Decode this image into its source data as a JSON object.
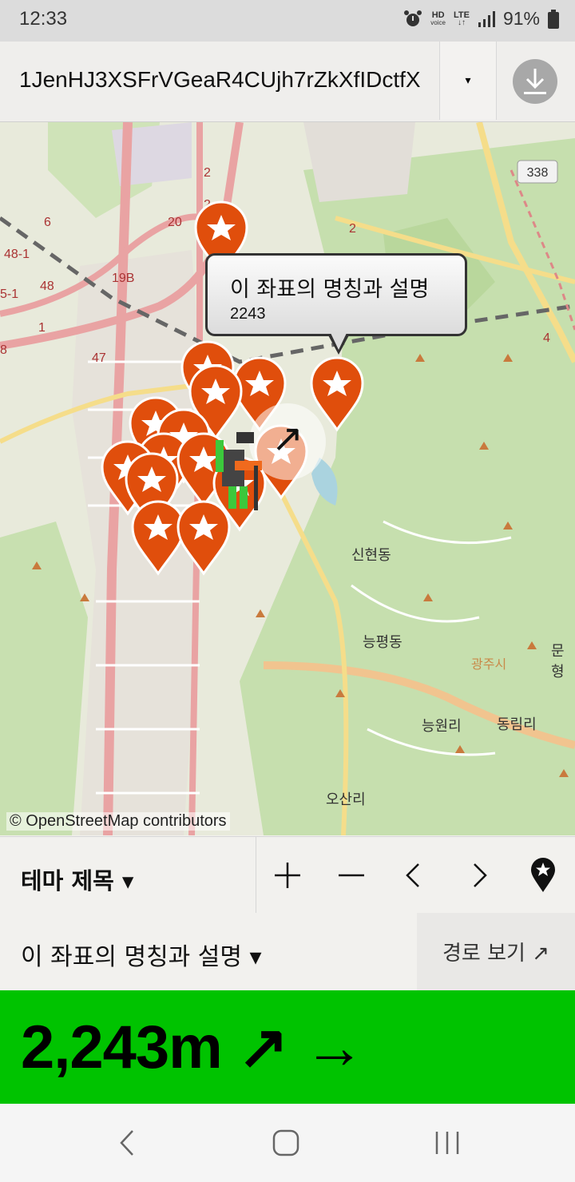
{
  "status": {
    "time": "12:33",
    "hd": "HD",
    "voice": "voice",
    "lte": "LTE",
    "battery": "91%"
  },
  "top": {
    "map_id": "1JenHJ3XSFrVGeaR4CUjh7rZkXfIDctfX",
    "dropdown_glyph": "▾",
    "download_icon": "download-icon"
  },
  "map": {
    "attribution": "© OpenStreetMap contributors",
    "places": [
      {
        "label": "신현동"
      },
      {
        "label": "능평동"
      },
      {
        "label": "능원리"
      },
      {
        "label": "동림리"
      },
      {
        "label": "오산리"
      },
      {
        "label": "문형"
      },
      {
        "label": "광주시"
      }
    ],
    "route_badges": [
      "338",
      "2",
      "2",
      "20",
      "19B",
      "6",
      "48-1",
      "48",
      "5-1",
      "1",
      "47",
      "8",
      "2",
      "4"
    ],
    "popup": {
      "title": "이 좌표의 명칭과 설명",
      "desc": "2243"
    },
    "direction_glyph": "↗",
    "marker_icon": "star-marker-icon",
    "marker_color": "#e04e0c"
  },
  "toolbar": {
    "theme_label": "테마 제목 ▾",
    "controls": [
      {
        "name": "zoom-in",
        "glyph": "+"
      },
      {
        "name": "zoom-out",
        "glyph": "—"
      },
      {
        "name": "prev",
        "glyph": "<"
      },
      {
        "name": "next",
        "glyph": ">"
      },
      {
        "name": "add-marker",
        "glyph": "marker"
      }
    ]
  },
  "info": {
    "name": "이 좌표의 명칭과 설명 ▾",
    "route": "경로 보기 ↗"
  },
  "distance": {
    "text": "2,243m ↗ →",
    "bg": "#00c300"
  }
}
